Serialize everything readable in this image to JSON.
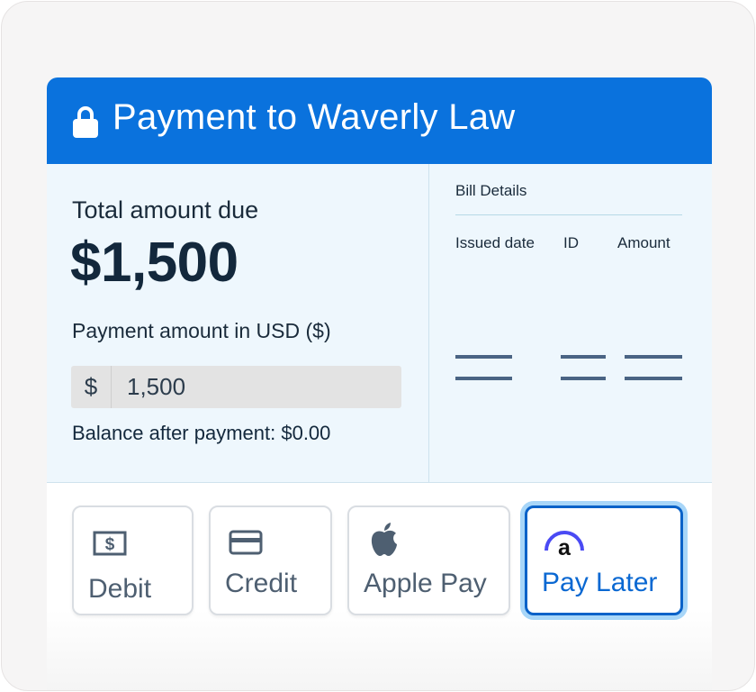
{
  "header": {
    "title": "Payment to Waverly Law"
  },
  "summary": {
    "total_label": "Total amount due",
    "total_value": "$1,500",
    "payment_label": "Payment amount in USD ($)",
    "currency_symbol": "$",
    "payment_value": "1,500",
    "balance_text": "Balance after payment: $0.00"
  },
  "bill": {
    "title": "Bill Details",
    "columns": [
      "Issued date",
      "ID",
      "Amount"
    ]
  },
  "methods": [
    {
      "label": "Debit",
      "icon": "dollar-bill-icon"
    },
    {
      "label": "Credit",
      "icon": "credit-card-icon"
    },
    {
      "label": "Apple Pay",
      "icon": "apple-icon"
    },
    {
      "label": "Pay Later",
      "icon": "affirm-logo-icon",
      "selected": true
    }
  ],
  "colors": {
    "header": "#0a72dd",
    "panel": "#eef7fd",
    "selected_border": "#0a62c8",
    "selected_glow": "#a8d6f8",
    "text_dark": "#13283c"
  }
}
